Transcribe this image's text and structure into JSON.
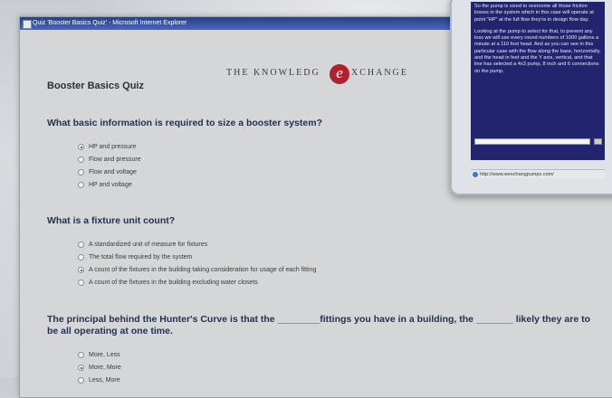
{
  "window": {
    "title": "Quiz 'Booster Basics Quiz' - Microsoft Internet Explorer"
  },
  "logo": {
    "text_left": "THE KNOWLEDG",
    "letter": "e",
    "text_right": "XCHANGE"
  },
  "quiz": {
    "title": "Booster Basics Quiz",
    "questions": [
      {
        "text": "What basic information is required to size a booster system?",
        "options": [
          {
            "label": "HP and pressure",
            "selected": true
          },
          {
            "label": "Flow and pressure",
            "selected": false
          },
          {
            "label": "Flow and voltage",
            "selected": false
          },
          {
            "label": "HP and voltage",
            "selected": false
          }
        ]
      },
      {
        "text": "What is a fixture unit count?",
        "options": [
          {
            "label": "A standardized unit of measure for fixtures",
            "selected": false
          },
          {
            "label": "The total flow required by the system",
            "selected": false
          },
          {
            "label": "A count of the fixtures in the building taking consideration for usage of each fitting",
            "selected": true
          },
          {
            "label": "A count of the fixtures in the building excluding water closets",
            "selected": false
          }
        ]
      },
      {
        "text": "The principal behind the Hunter's Curve is that the ________fittings you have in a building, the _______ likely they are to be all operating at one time.",
        "options": [
          {
            "label": "More, Less",
            "selected": false
          },
          {
            "label": "More, More",
            "selected": true
          },
          {
            "label": "Less, More",
            "selected": false
          }
        ]
      }
    ]
  },
  "popup": {
    "paragraph1": "So the pump is sized to overcome all those friction losses in the system which in this case will operate at point \"HP\" at the full flow they're in design flow day.",
    "paragraph2": "Looking at the pump to select for that, to prevent any loss we will use every round numbers of 1000 gallons a minute at a 110 foot head. And as you can see in this particular case with the flow along the base, horizontally, and the head in feet and the Y axis, vertical, and that line has selected a 4x3 pump, 8 inch and 6 connections on the pump.",
    "status_url": "http://www.weschangpumps.com/"
  }
}
